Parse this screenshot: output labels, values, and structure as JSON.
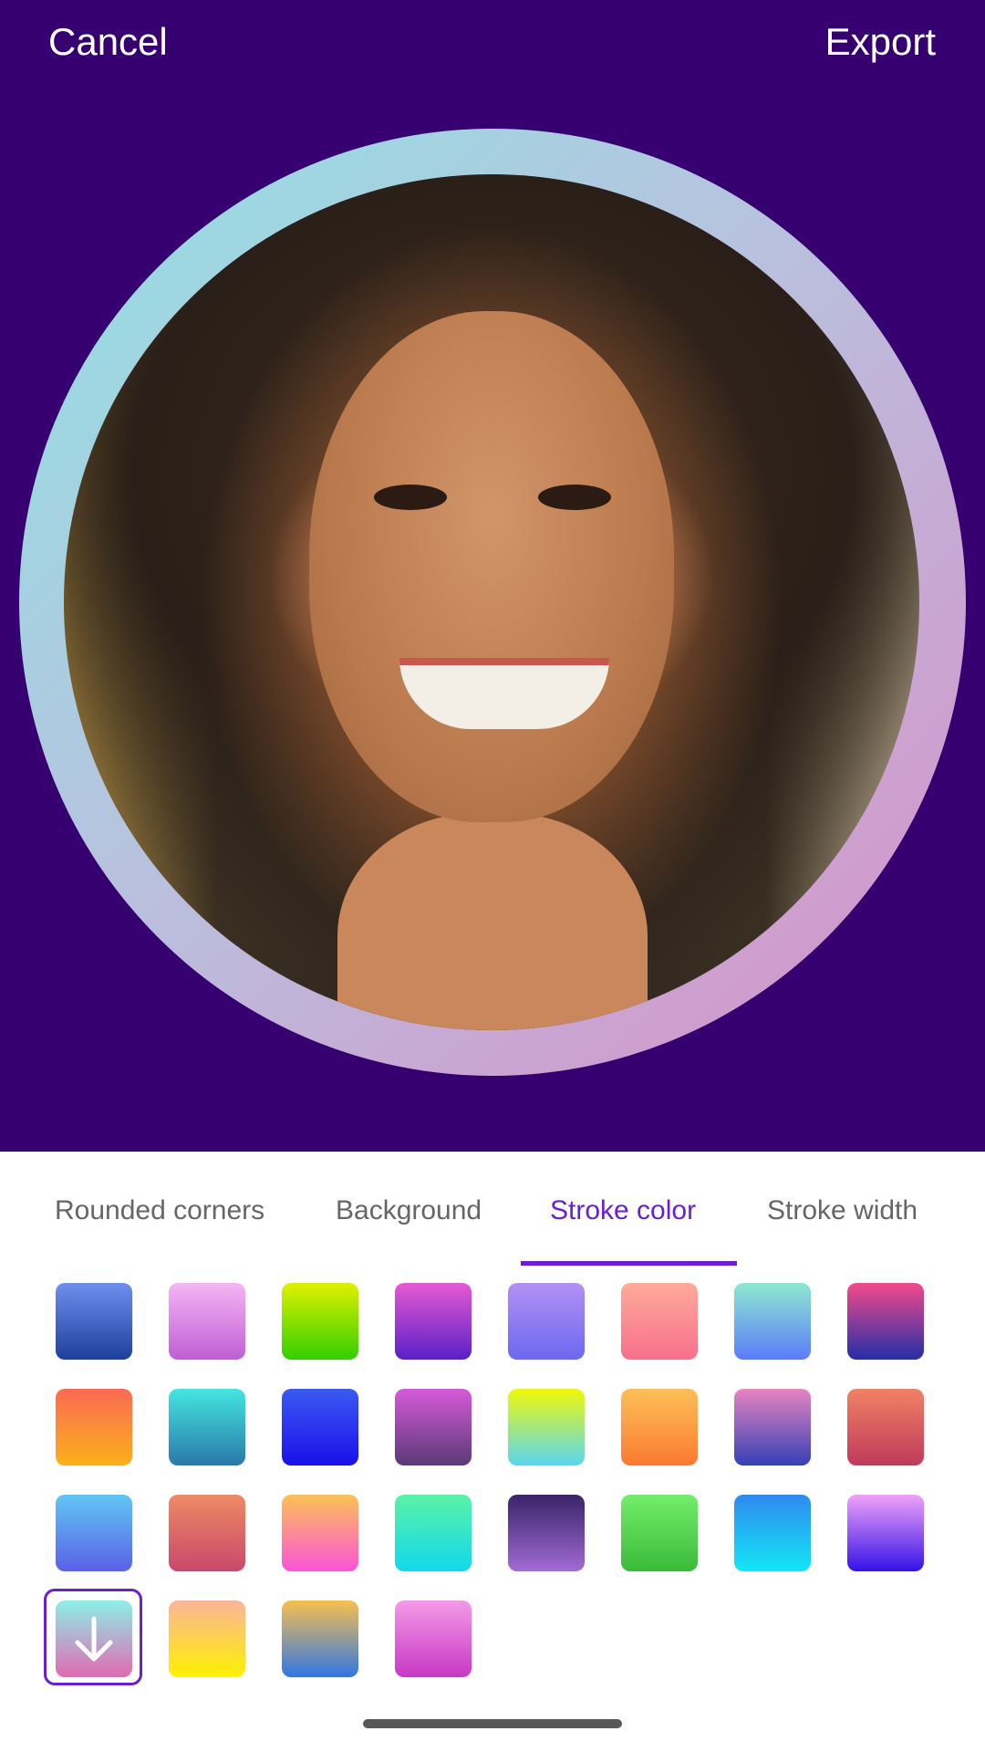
{
  "header": {
    "cancel_label": "Cancel",
    "export_label": "Export"
  },
  "canvas": {
    "background_color": "#370070",
    "stroke_gradient": [
      "#8fe3e4",
      "#b8c2de",
      "#d88ec8"
    ]
  },
  "tabs": [
    {
      "label": "Rounded corners",
      "active": false
    },
    {
      "label": "Background",
      "active": false
    },
    {
      "label": "Stroke color",
      "active": true
    },
    {
      "label": "Stroke width",
      "active": false
    }
  ],
  "swatches": [
    {
      "from": "#6f8ff0",
      "to": "#1f3f9c"
    },
    {
      "from": "#f4b6f4",
      "to": "#c05ed4"
    },
    {
      "from": "#e0f000",
      "to": "#32cf00"
    },
    {
      "from": "#e65ad2",
      "to": "#5a1fc8"
    },
    {
      "from": "#b390f4",
      "to": "#6c68f0"
    },
    {
      "from": "#ffab9a",
      "to": "#f76f8c"
    },
    {
      "from": "#8de8d0",
      "to": "#5b7cf8"
    },
    {
      "from": "#f24a8a",
      "to": "#232ea6"
    },
    {
      "from": "#fb6a54",
      "to": "#fbb01a"
    },
    {
      "from": "#44e6e0",
      "to": "#2a78a8"
    },
    {
      "from": "#3b5af2",
      "to": "#1b10ea"
    },
    {
      "from": "#d65ad8",
      "to": "#5a3a78"
    },
    {
      "from": "#f0f80a",
      "to": "#58d6f2"
    },
    {
      "from": "#fcc058",
      "to": "#fb7a30"
    },
    {
      "from": "#e784c0",
      "to": "#3440b6"
    },
    {
      "from": "#f08266",
      "to": "#c03a5a"
    },
    {
      "from": "#61c6f4",
      "to": "#5b60e8"
    },
    {
      "from": "#ee8a64",
      "to": "#c8486c"
    },
    {
      "from": "#fcc254",
      "to": "#fb54d8"
    },
    {
      "from": "#5af2a6",
      "to": "#12d8ec"
    },
    {
      "from": "#3a2468",
      "to": "#a26ad6"
    },
    {
      "from": "#74ee6a",
      "to": "#3aba3a"
    },
    {
      "from": "#2f8af0",
      "to": "#14e6f6"
    },
    {
      "from": "#f0a2f8",
      "to": "#3412e8"
    },
    {
      "from": "#8cefe8",
      "to": "#e06ab2"
    },
    {
      "from": "#fbb49a",
      "to": "#fff200"
    },
    {
      "from": "#f8c04e",
      "to": "#3076e4"
    },
    {
      "from": "#f49ae8",
      "to": "#c838c4"
    }
  ],
  "selected_swatch_icon": "arrow-down-icon"
}
